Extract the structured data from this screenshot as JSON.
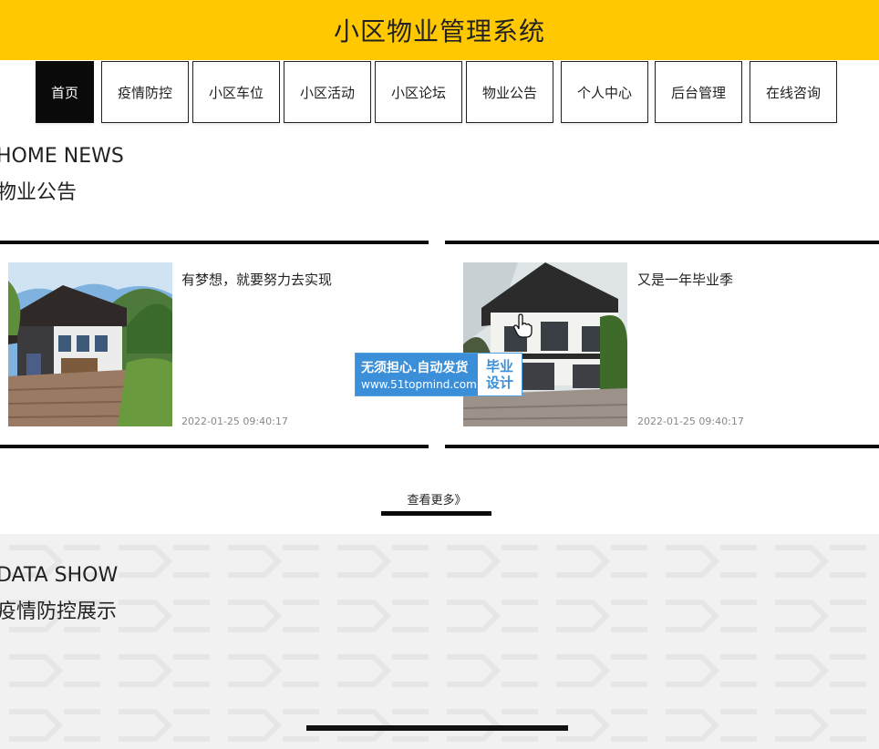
{
  "app": {
    "title": "小区物业管理系统"
  },
  "nav": {
    "items": [
      {
        "label": "首页",
        "active": true
      },
      {
        "label": "疫情防控",
        "active": false
      },
      {
        "label": "小区车位",
        "active": false
      },
      {
        "label": "小区活动",
        "active": false
      },
      {
        "label": "小区论坛",
        "active": false
      },
      {
        "label": "物业公告",
        "active": false
      },
      {
        "label": "个人中心",
        "active": false
      },
      {
        "label": "后台管理",
        "active": false
      },
      {
        "label": "在线咨询",
        "active": false
      }
    ]
  },
  "news": {
    "heading_en": "HOME NEWS",
    "heading_cn": "物业公告",
    "cards": [
      {
        "title": "有梦想，就要努力去实现",
        "time": "2022-01-25 09:40:17",
        "image": "house-photo-1"
      },
      {
        "title": "又是一年毕业季",
        "time": "2022-01-25 09:40:17",
        "image": "house-photo-2"
      }
    ],
    "more_label": "查看更多》"
  },
  "data_show": {
    "heading_en": "DATA SHOW",
    "heading_cn": "疫情防控展示"
  },
  "watermark": {
    "line1": "无须担心.自动发货",
    "line2": "www.51topmind.com",
    "right1": "毕业",
    "right2": "设计"
  },
  "colors": {
    "header_bg": "#ffc800",
    "active_nav_bg": "#0a0a0a",
    "text": "#222222",
    "badge_blue": "#3b8fd8"
  }
}
